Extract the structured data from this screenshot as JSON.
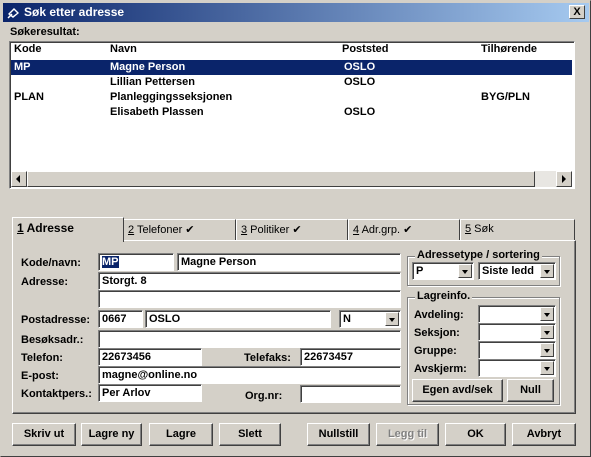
{
  "window": {
    "title": "Søk etter adresse",
    "close_label": "X"
  },
  "results": {
    "label": "Søkeresultat:",
    "columns": [
      "Kode",
      "Navn",
      "Poststed",
      "Tilhørende"
    ],
    "rows": [
      {
        "kode": "MP",
        "navn": "Magne Person",
        "poststed": "OSLO",
        "tilhorende": "",
        "selected": true
      },
      {
        "kode": "",
        "navn": "Lillian Pettersen",
        "poststed": "OSLO",
        "tilhorende": "",
        "selected": false
      },
      {
        "kode": "PLAN",
        "navn": "Planleggingsseksjonen",
        "poststed": "",
        "tilhorende": "BYG/PLN",
        "selected": false
      },
      {
        "kode": "",
        "navn": "Elisabeth Plassen",
        "poststed": "OSLO",
        "tilhorende": "",
        "selected": false
      }
    ]
  },
  "tabs": [
    {
      "num": "1",
      "label": " Adresse",
      "check": ""
    },
    {
      "num": "2",
      "label": " Telefoner ",
      "check": "✔"
    },
    {
      "num": "3",
      "label": " Politiker ",
      "check": "✔"
    },
    {
      "num": "4",
      "label": " Adr.grp. ",
      "check": "✔"
    },
    {
      "num": "5",
      "label": " Søk",
      "check": ""
    }
  ],
  "form": {
    "kode_label": "Kode/navn:",
    "kode_value": "MP",
    "navn_value": "Magne Person",
    "adresse_label": "Adresse:",
    "adresse_value": "Storgt. 8",
    "adresse2_value": "",
    "postadresse_label": "Postadresse:",
    "postnr_value": "0667",
    "poststed_value": "OSLO",
    "land_value": "N",
    "besoksadr_label": "Besøksadr.:",
    "besoksadr_value": "",
    "telefon_label": "Telefon:",
    "telefon_value": "22673456",
    "telefaks_label": "Telefaks:",
    "telefaks_value": "22673457",
    "epost_label": "E-post:",
    "epost_value": "magne@online.no",
    "kontakt_label": "Kontaktpers.:",
    "kontakt_value": "Per Arlov",
    "orgnr_label": "Org.nr:",
    "orgnr_value": ""
  },
  "adressetype": {
    "title": "Adressetype / sortering",
    "type_value": "P",
    "sort_value": "Siste ledd"
  },
  "lagreinfo": {
    "title": "Lagreinfo.",
    "avdeling_label": "Avdeling:",
    "seksjon_label": "Seksjon:",
    "gruppe_label": "Gruppe:",
    "avskjerm_label": "Avskjerm:",
    "egen_button": "Egen avd/sek",
    "null_button": "Null"
  },
  "buttons": {
    "skriv_ut": "Skriv ut",
    "lagre_ny": "Lagre ny",
    "lagre": "Lagre",
    "slett": "Slett",
    "nullstill": "Nullstill",
    "legg_til": "Legg til",
    "ok": "OK",
    "avbryt": "Avbryt"
  }
}
